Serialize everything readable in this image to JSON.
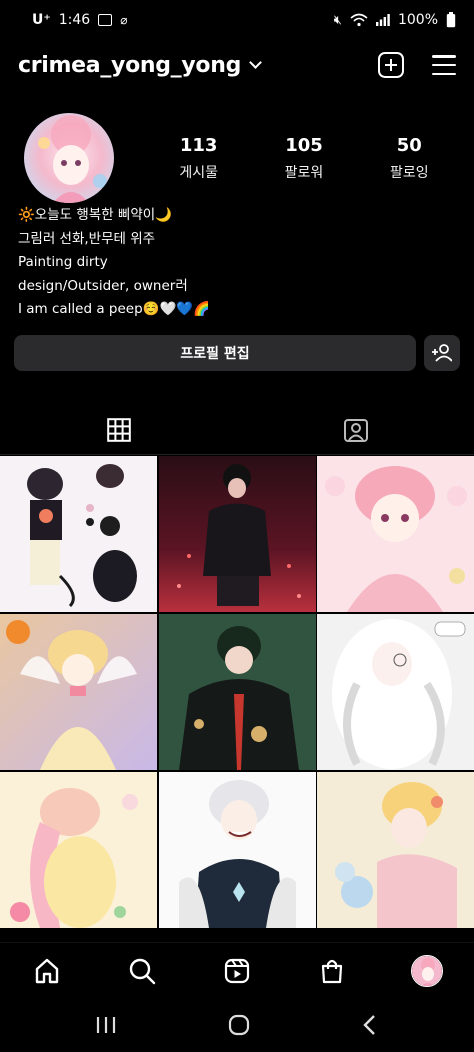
{
  "status_bar": {
    "carrier": "U⁺",
    "time": "1:46",
    "battery": "100%"
  },
  "header": {
    "username": "crimea_yong_yong"
  },
  "stats": [
    {
      "value": "113",
      "label": "게시물"
    },
    {
      "value": "105",
      "label": "팔로워"
    },
    {
      "value": "50",
      "label": "팔로잉"
    }
  ],
  "bio": {
    "line1": "🔆오늘도 행복한 삐약이🌙",
    "line2": "그림러 선화,반무테 위주",
    "line3": "Painting dirty",
    "line4": "design/Outsider, owner러",
    "line5": "I am called a peep☺️🤍💙🌈"
  },
  "buttons": {
    "edit_profile": "프로필 편집"
  },
  "colors": {
    "background": "#000000",
    "button_bg": "#2b2b2d",
    "text": "#ffffff"
  },
  "grid": {
    "posts": [
      {
        "name": "post-1"
      },
      {
        "name": "post-2"
      },
      {
        "name": "post-3"
      },
      {
        "name": "post-4"
      },
      {
        "name": "post-5"
      },
      {
        "name": "post-6"
      },
      {
        "name": "post-7"
      },
      {
        "name": "post-8"
      },
      {
        "name": "post-9"
      }
    ]
  },
  "bottom_nav": [
    "home-icon",
    "search-icon",
    "reels-icon",
    "shop-icon",
    "profile-avatar"
  ]
}
